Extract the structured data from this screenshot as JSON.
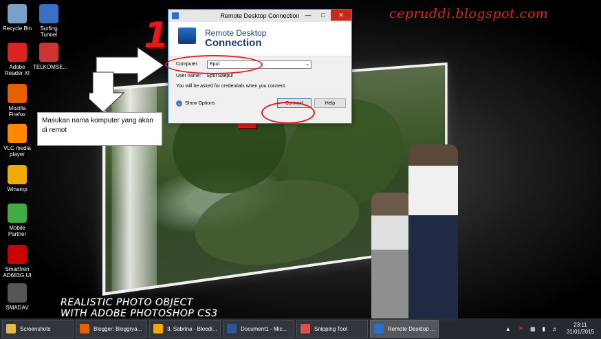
{
  "brand": "cepruddi.blogspot.com",
  "desktop_icons": [
    {
      "label": "Recycle Bin",
      "icon": "recycle-bin-icon"
    },
    {
      "label": "Surfing\nTunnel",
      "icon": "surfing-tunnel-icon"
    },
    {
      "label": "Adobe\nReader XI",
      "icon": "adobe-reader-icon"
    },
    {
      "label": "TELKOMSE...",
      "icon": "telkomsel-icon"
    },
    {
      "label": "Mozilla\nFirefox",
      "icon": "firefox-icon"
    },
    {
      "label": "VLC media\nplayer",
      "icon": "vlc-icon"
    },
    {
      "label": "Winamp",
      "icon": "winamp-icon"
    },
    {
      "label": "Mobile\nPartner",
      "icon": "mobile-partner-icon"
    },
    {
      "label": "Smartfren\nAD683G UI",
      "icon": "smartfren-icon"
    },
    {
      "label": "SMADAV",
      "icon": "smadav-icon"
    }
  ],
  "annotation": {
    "step1": "1",
    "step2": "2",
    "note": "Masukan nama komputer yang akan di remot",
    "caption_line1": "REALISTIC PHOTO OBJECT",
    "caption_line2": "WITH ADOBE PHOTOSHOP CS3"
  },
  "rdc": {
    "window_title": "Remote Desktop Connection",
    "heading_line1": "Remote Desktop",
    "heading_line2": "Connection",
    "computer_label": "Computer:",
    "computer_value": "Epul",
    "username_label": "User name:",
    "username_value": "Epul Saepul",
    "credentials_note": "You will be asked for credentials when you connect.",
    "show_options": "Show Options",
    "connect_button": "Connect",
    "help_button": "Help"
  },
  "taskbar": {
    "items": [
      {
        "label": "Screenshots",
        "icon": "folder-icon",
        "color": "#e8b84a"
      },
      {
        "label": "Blogger: Bloggrya...",
        "icon": "firefox-icon",
        "color": "#e66000"
      },
      {
        "label": "3. Sabrina - Bleedi...",
        "icon": "winamp-icon",
        "color": "#f2a900"
      },
      {
        "label": "Document1 - Mic...",
        "icon": "word-icon",
        "color": "#2b579a"
      },
      {
        "label": "Snipping Tool",
        "icon": "snipping-tool-icon",
        "color": "#d9534f"
      },
      {
        "label": "Remote Desktop ...",
        "icon": "remote-desktop-icon",
        "color": "#2a6fc9"
      }
    ],
    "time": "23:11",
    "date": "31/01/2015"
  },
  "colors": {
    "accent_red": "#e31b1b",
    "rdc_blue": "#1a3d7a"
  }
}
